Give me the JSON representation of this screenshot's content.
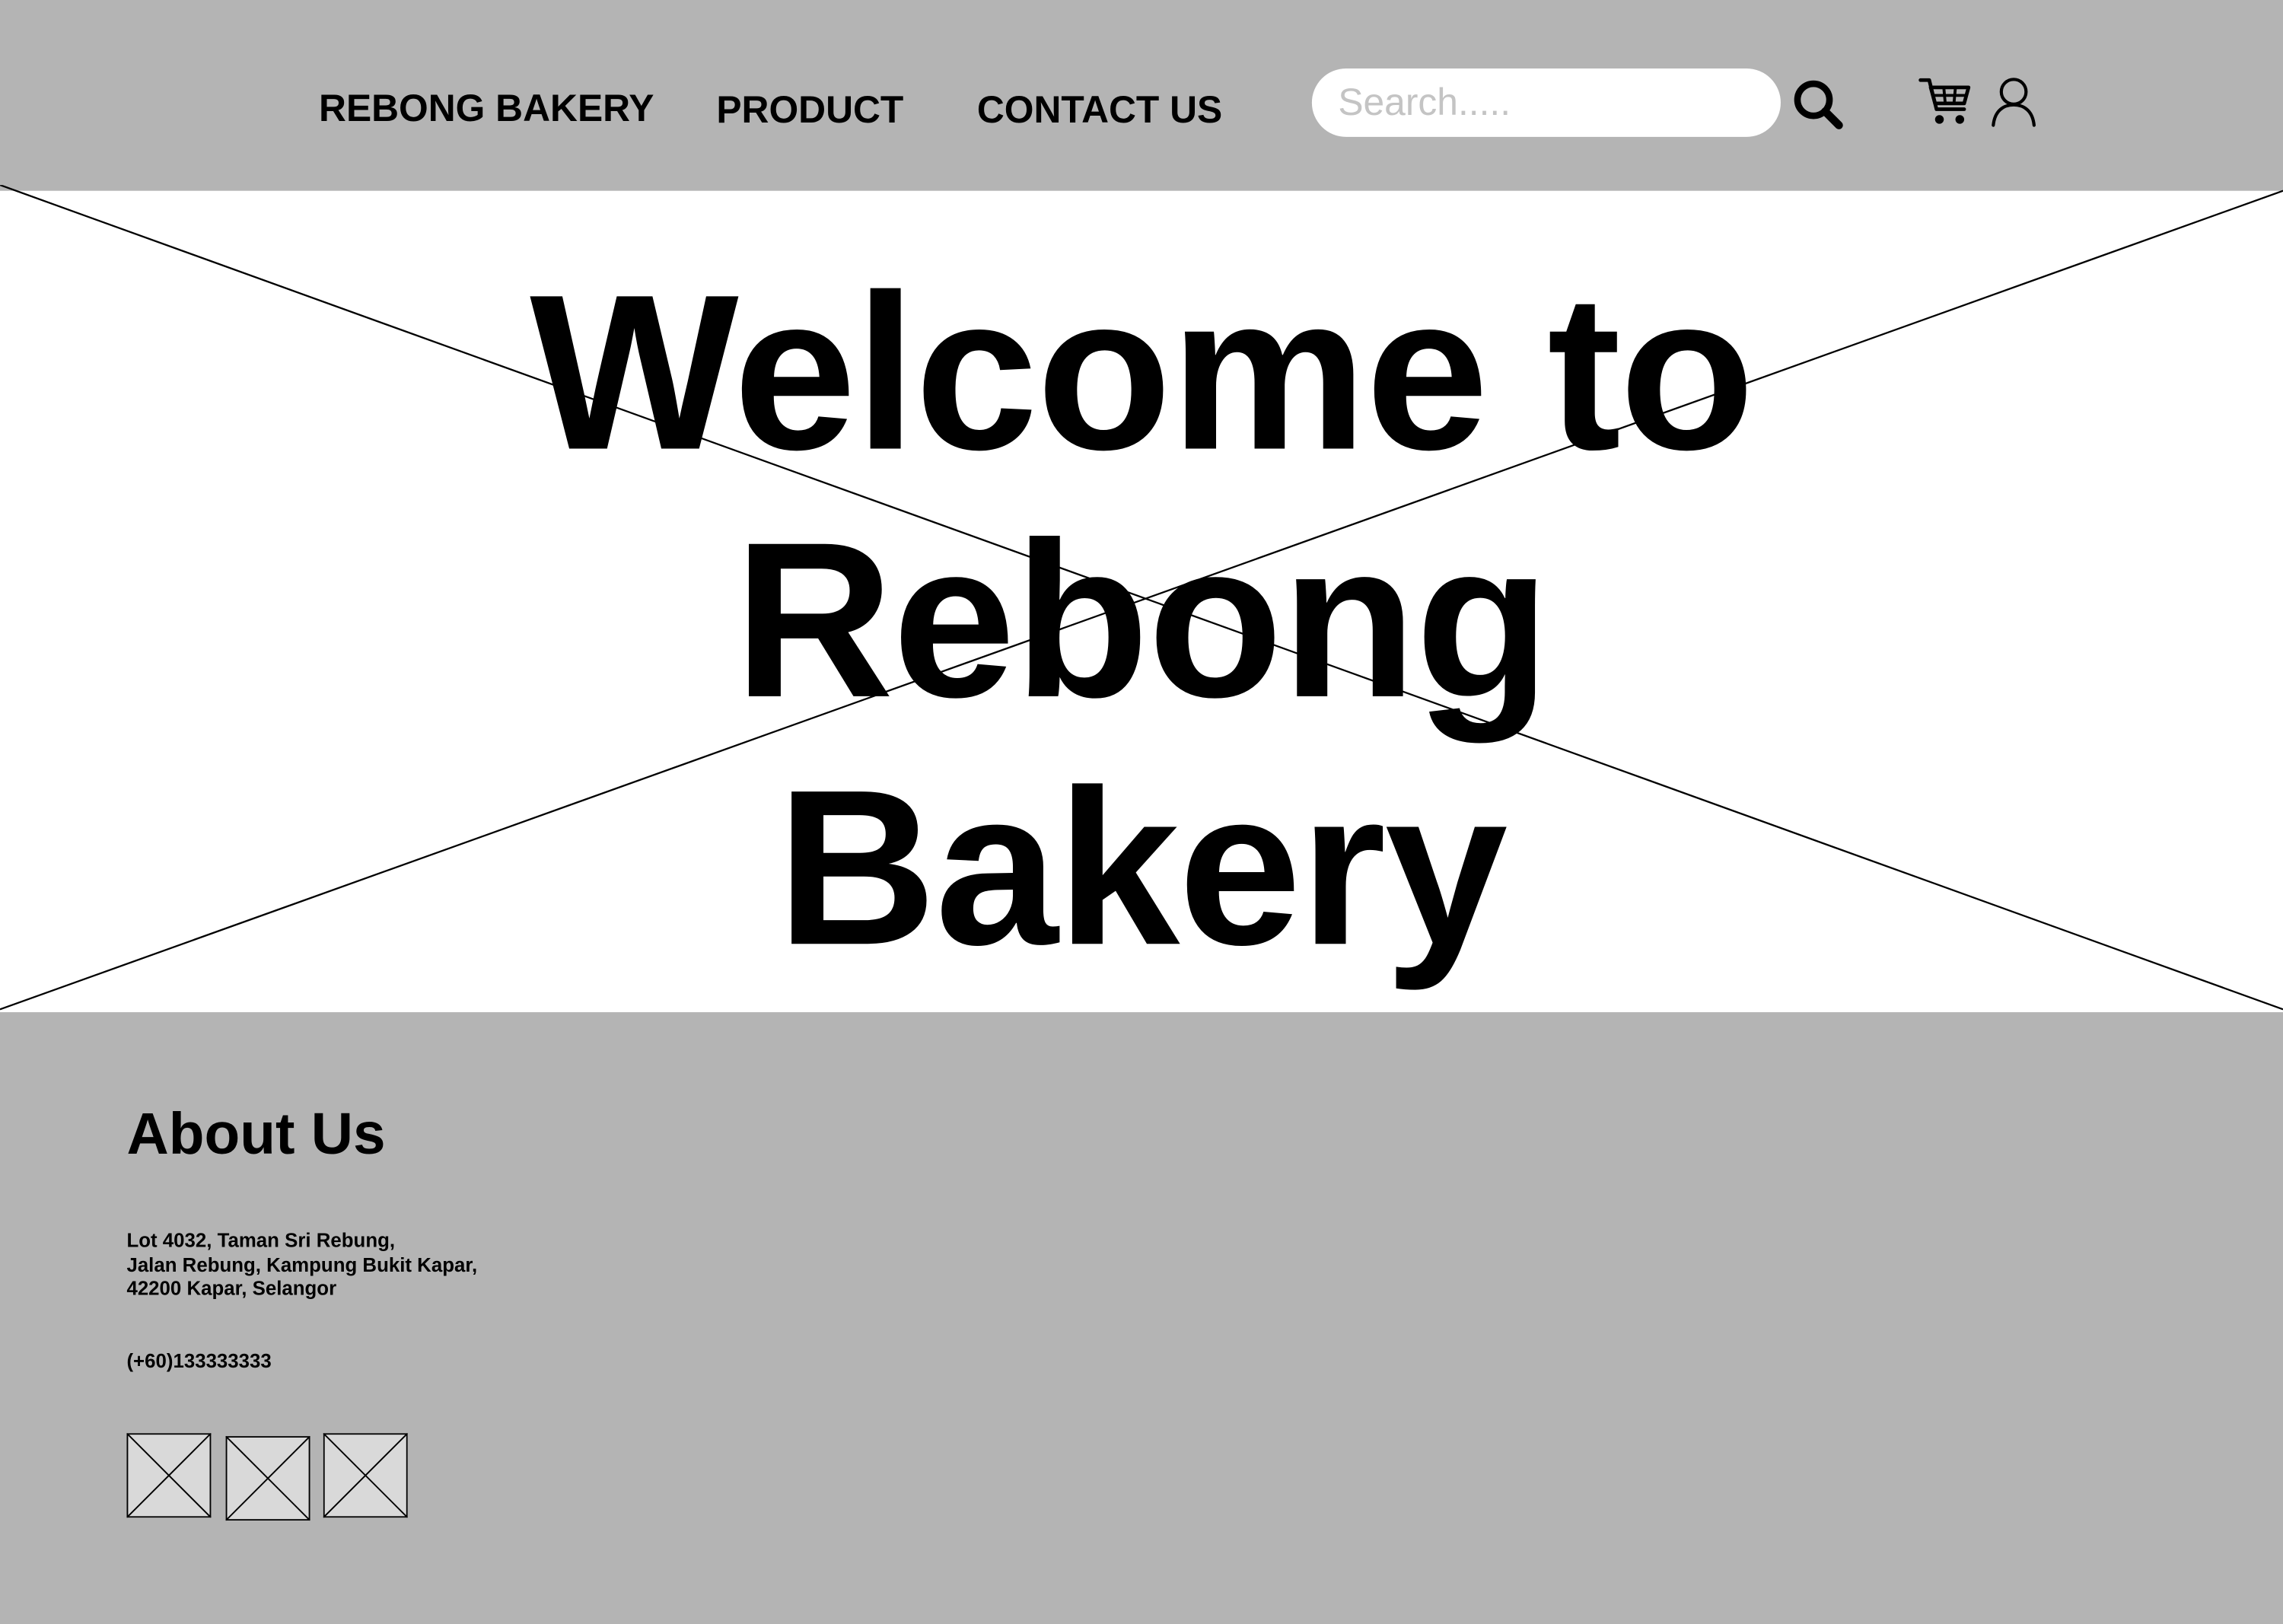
{
  "header": {
    "brand": "REBONG BAKERY",
    "nav": [
      {
        "label": "PRODUCT"
      },
      {
        "label": "CONTACT US"
      }
    ],
    "search": {
      "placeholder": "Search.....",
      "value": ""
    },
    "icons": [
      "search-icon",
      "cart-icon",
      "user-icon"
    ]
  },
  "hero": {
    "title_lines": [
      "Welcome to",
      "Rebong",
      "Bakery"
    ],
    "background": "image-placeholder"
  },
  "footer": {
    "heading": "About Us",
    "address_lines": [
      "Lot 4032, Taman Sri Rebung,",
      "Jalan Rebung, Kampung Bukit Kapar,",
      "42200 Kapar, Selangor"
    ],
    "phone": "(+60)133333333",
    "social_links": [
      "social-placeholder-1",
      "social-placeholder-2",
      "social-placeholder-3"
    ]
  },
  "colors": {
    "panel": "#b4b4b4",
    "hero_bg": "#ffffff",
    "text": "#000000",
    "search_bg": "#ffffff",
    "placeholder_tile": "#d9d9d9"
  }
}
